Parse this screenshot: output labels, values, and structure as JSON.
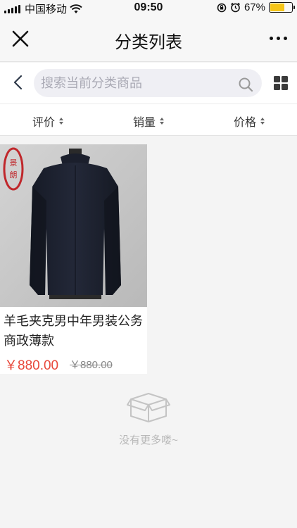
{
  "status_bar": {
    "carrier": "中国移动",
    "time": "09:50",
    "battery_percent": "67%",
    "battery_level": 0.67,
    "battery_color": "#f5c518"
  },
  "navbar": {
    "title": "分类列表",
    "close_icon": "close-icon",
    "more_icon": "more-icon"
  },
  "search": {
    "placeholder": "搜索当前分类商品",
    "value": ""
  },
  "sort": {
    "items": [
      {
        "label": "评价"
      },
      {
        "label": "销量"
      },
      {
        "label": "价格"
      }
    ]
  },
  "products": [
    {
      "title": "羊毛夹克男中年男装公务商政薄款",
      "price": "￥880.00",
      "original_price": "￥880.00",
      "image": "navy-jacket-on-mannequin",
      "seal_text": "景朗"
    }
  ],
  "footer": {
    "empty_text": "没有更多喽~"
  },
  "colors": {
    "price": "#e8483b",
    "background": "#f4f4f4"
  }
}
